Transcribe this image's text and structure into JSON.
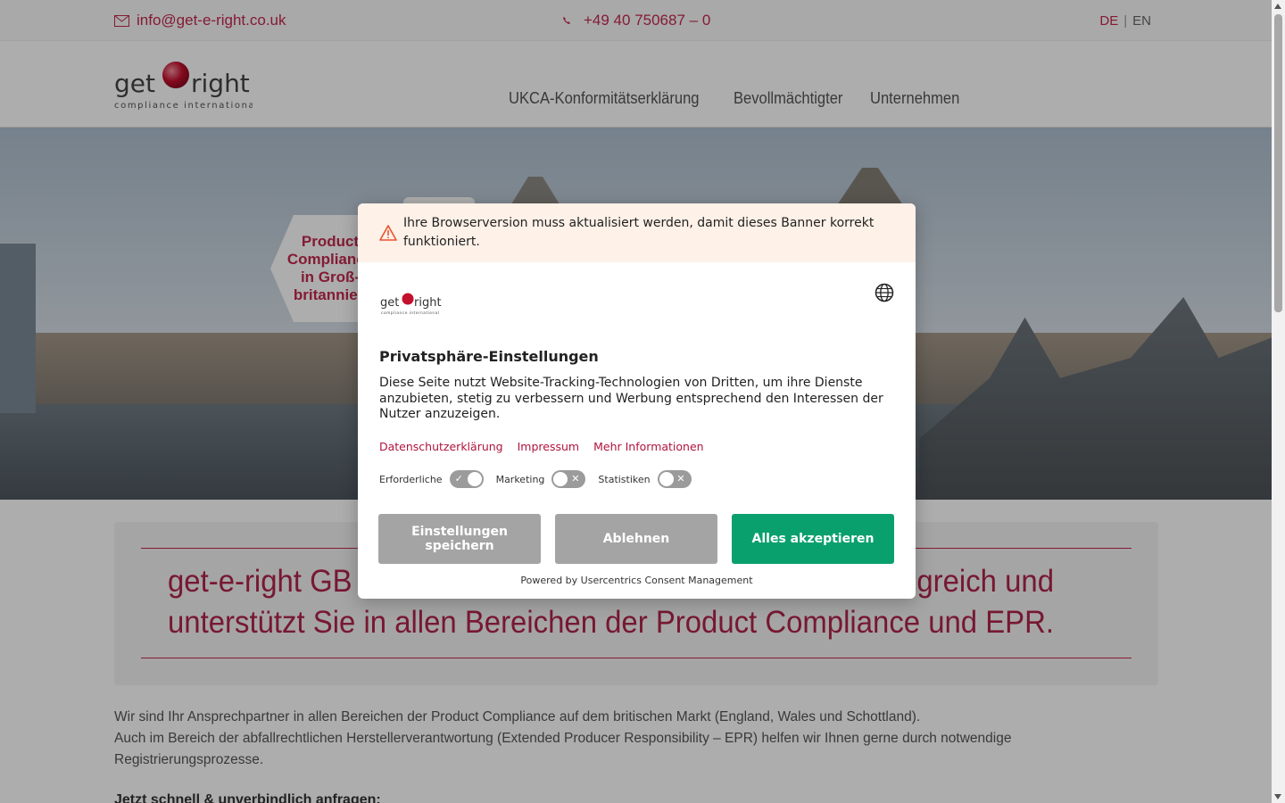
{
  "topbar": {
    "email": "info@get-e-right.co.uk",
    "phone": "+49 40 750687 – 0",
    "lang_de": "DE",
    "lang_sep": "|",
    "lang_en": "EN"
  },
  "header": {
    "logo_word": "get right",
    "logo_sub": "compliance international",
    "nav": [
      "UKCA-Konformitätserklärung",
      "Bevollmächtigter",
      "Unternehmen"
    ]
  },
  "hero": {
    "badge": "Product Compliance in Groß-britannien"
  },
  "intro": {
    "title": "get-e-right GB ist Ihr Ansprechpartner im Vereinigten Königreich und unterstützt Sie in allen Bereichen der Product Compliance und EPR."
  },
  "body": {
    "p1": "Wir sind Ihr Ansprechpartner in allen Bereichen der Product Compliance auf dem britischen Markt (England, Wales und Schottland).",
    "p2": "Auch im Bereich der abfallrechtlichen Herstellerverantwortung (Extended Producer Responsibility – EPR) helfen wir Ihnen gerne durch notwendige Registrierungsprozesse.",
    "cta": "Jetzt schnell & unverbindlich anfragen:"
  },
  "consent": {
    "warning": "Ihre Browserversion muss aktualisiert werden, damit dieses Banner korrekt funktioniert.",
    "logo_word": "get right",
    "logo_sub": "compliance international",
    "title": "Privatsphäre-Einstellungen",
    "description": "Diese Seite nutzt Website-Tracking-Technologien von Dritten, um ihre Dienste anzubieten, stetig zu verbessern und Werbung entsprechend den Interessen der Nutzer anzuzeigen.",
    "links": [
      "Datenschutzerklärung",
      "Impressum",
      "Mehr Informationen"
    ],
    "toggles": [
      {
        "label": "Erforderliche",
        "on": true
      },
      {
        "label": "Marketing",
        "on": false
      },
      {
        "label": "Statistiken",
        "on": false
      }
    ],
    "btn_save": "Einstellungen speichern",
    "btn_deny": "Ablehnen",
    "btn_accept": "Alles akzeptieren",
    "powered": "Powered by Usercentrics Consent Management"
  },
  "colors": {
    "brand": "#c3284d",
    "accept": "#0aa06e",
    "grey_button": "#a4a4a4",
    "warning_bg": "#fdf1e8"
  }
}
